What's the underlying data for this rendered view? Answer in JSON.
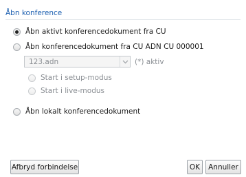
{
  "dialog": {
    "title": "Åbn konference"
  },
  "options": {
    "active_doc": {
      "label": "Åbn aktivt konferencedokument fra CU",
      "selected": true
    },
    "from_cu": {
      "label": "Åbn konferencedokument fra CU ADN CU 000001",
      "selected": false
    },
    "local_doc": {
      "label": "Åbn lokalt konferencedokument",
      "selected": false
    }
  },
  "cu_file": {
    "selected_value": "123.adn",
    "active_marker": "(*) aktiv"
  },
  "start_modes": {
    "setup": {
      "label": "Start i setup-modus",
      "selected": false
    },
    "live": {
      "label": "Start i live-modus",
      "selected": false
    }
  },
  "buttons": {
    "disconnect": "Afbryd forbindelse",
    "ok": "OK",
    "cancel": "Annuller"
  },
  "icons": {
    "dropdown": "chevron-down-icon"
  }
}
